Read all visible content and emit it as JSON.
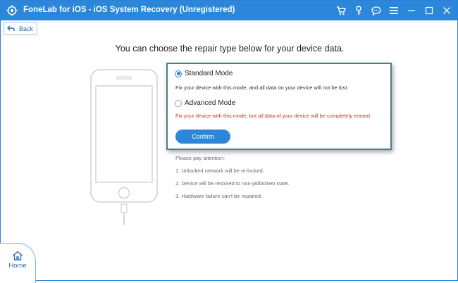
{
  "window": {
    "title": "FoneLab for iOS - iOS System Recovery (Unregistered)",
    "accent_color": "#2b87d9",
    "titlebar_icons": [
      "cart-icon",
      "key-icon",
      "chat-icon",
      "menu-icon",
      "minimize-icon",
      "maximize-icon",
      "close-icon"
    ]
  },
  "nav": {
    "back_label": "Back",
    "home_label": "Home"
  },
  "main": {
    "heading": "You can choose the repair type below for your device data.",
    "options": [
      {
        "label": "Standard Mode",
        "selected": true,
        "description": "Fix your device with this mode, and all data on your device will not be lost."
      },
      {
        "label": "Advanced Mode",
        "selected": false,
        "description": "Fix your device with this mode, but all data of your device will be completely erased."
      }
    ],
    "confirm_label": "Confirm",
    "notes_title": "Please pay attention:",
    "notes": [
      "1. Unlocked network will be re-locked.",
      "2. Device will be restored to non-jailbroken state.",
      "3. Hardware failure can't be repaired."
    ]
  }
}
